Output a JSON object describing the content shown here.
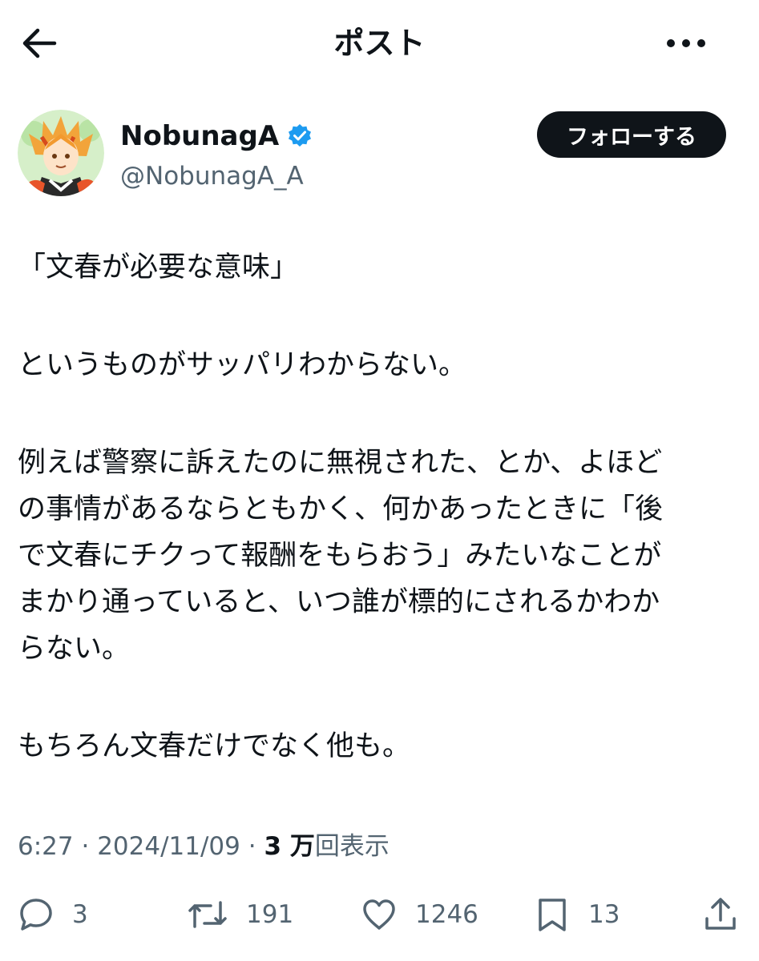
{
  "header": {
    "title": "ポスト",
    "back_icon": "arrow-left-icon",
    "more_icon": "more-horizontal-icon"
  },
  "author": {
    "name": "NobunagA",
    "handle": "@NobunagA_A",
    "verified": true,
    "follow_label": "フォローする"
  },
  "post": {
    "paragraphs": [
      [
        "「文春が必要な意味」"
      ],
      [
        "というものがサッパリわからない。"
      ],
      [
        "例えば警察に訴えたのに無視された、とか、よほど",
        "の事情があるならともかく、何かあったときに「後",
        "で文春にチクって報酬をもらおう」みたいなことが",
        "まかり通っていると、いつ誰が標的にされるかわか",
        "らない。"
      ],
      [
        "もちろん文春だけでなく他も。"
      ]
    ]
  },
  "meta": {
    "time": "6:27",
    "date": "2024/11/09",
    "views_count": "3 万",
    "views_label": "回表示"
  },
  "actions": {
    "reply_count": "3",
    "repost_count": "191",
    "like_count": "1246",
    "bookmark_count": "13"
  },
  "colors": {
    "text": "#0f1419",
    "secondary": "#536471",
    "verified": "#1d9bf0",
    "button_bg": "#0f1419"
  }
}
